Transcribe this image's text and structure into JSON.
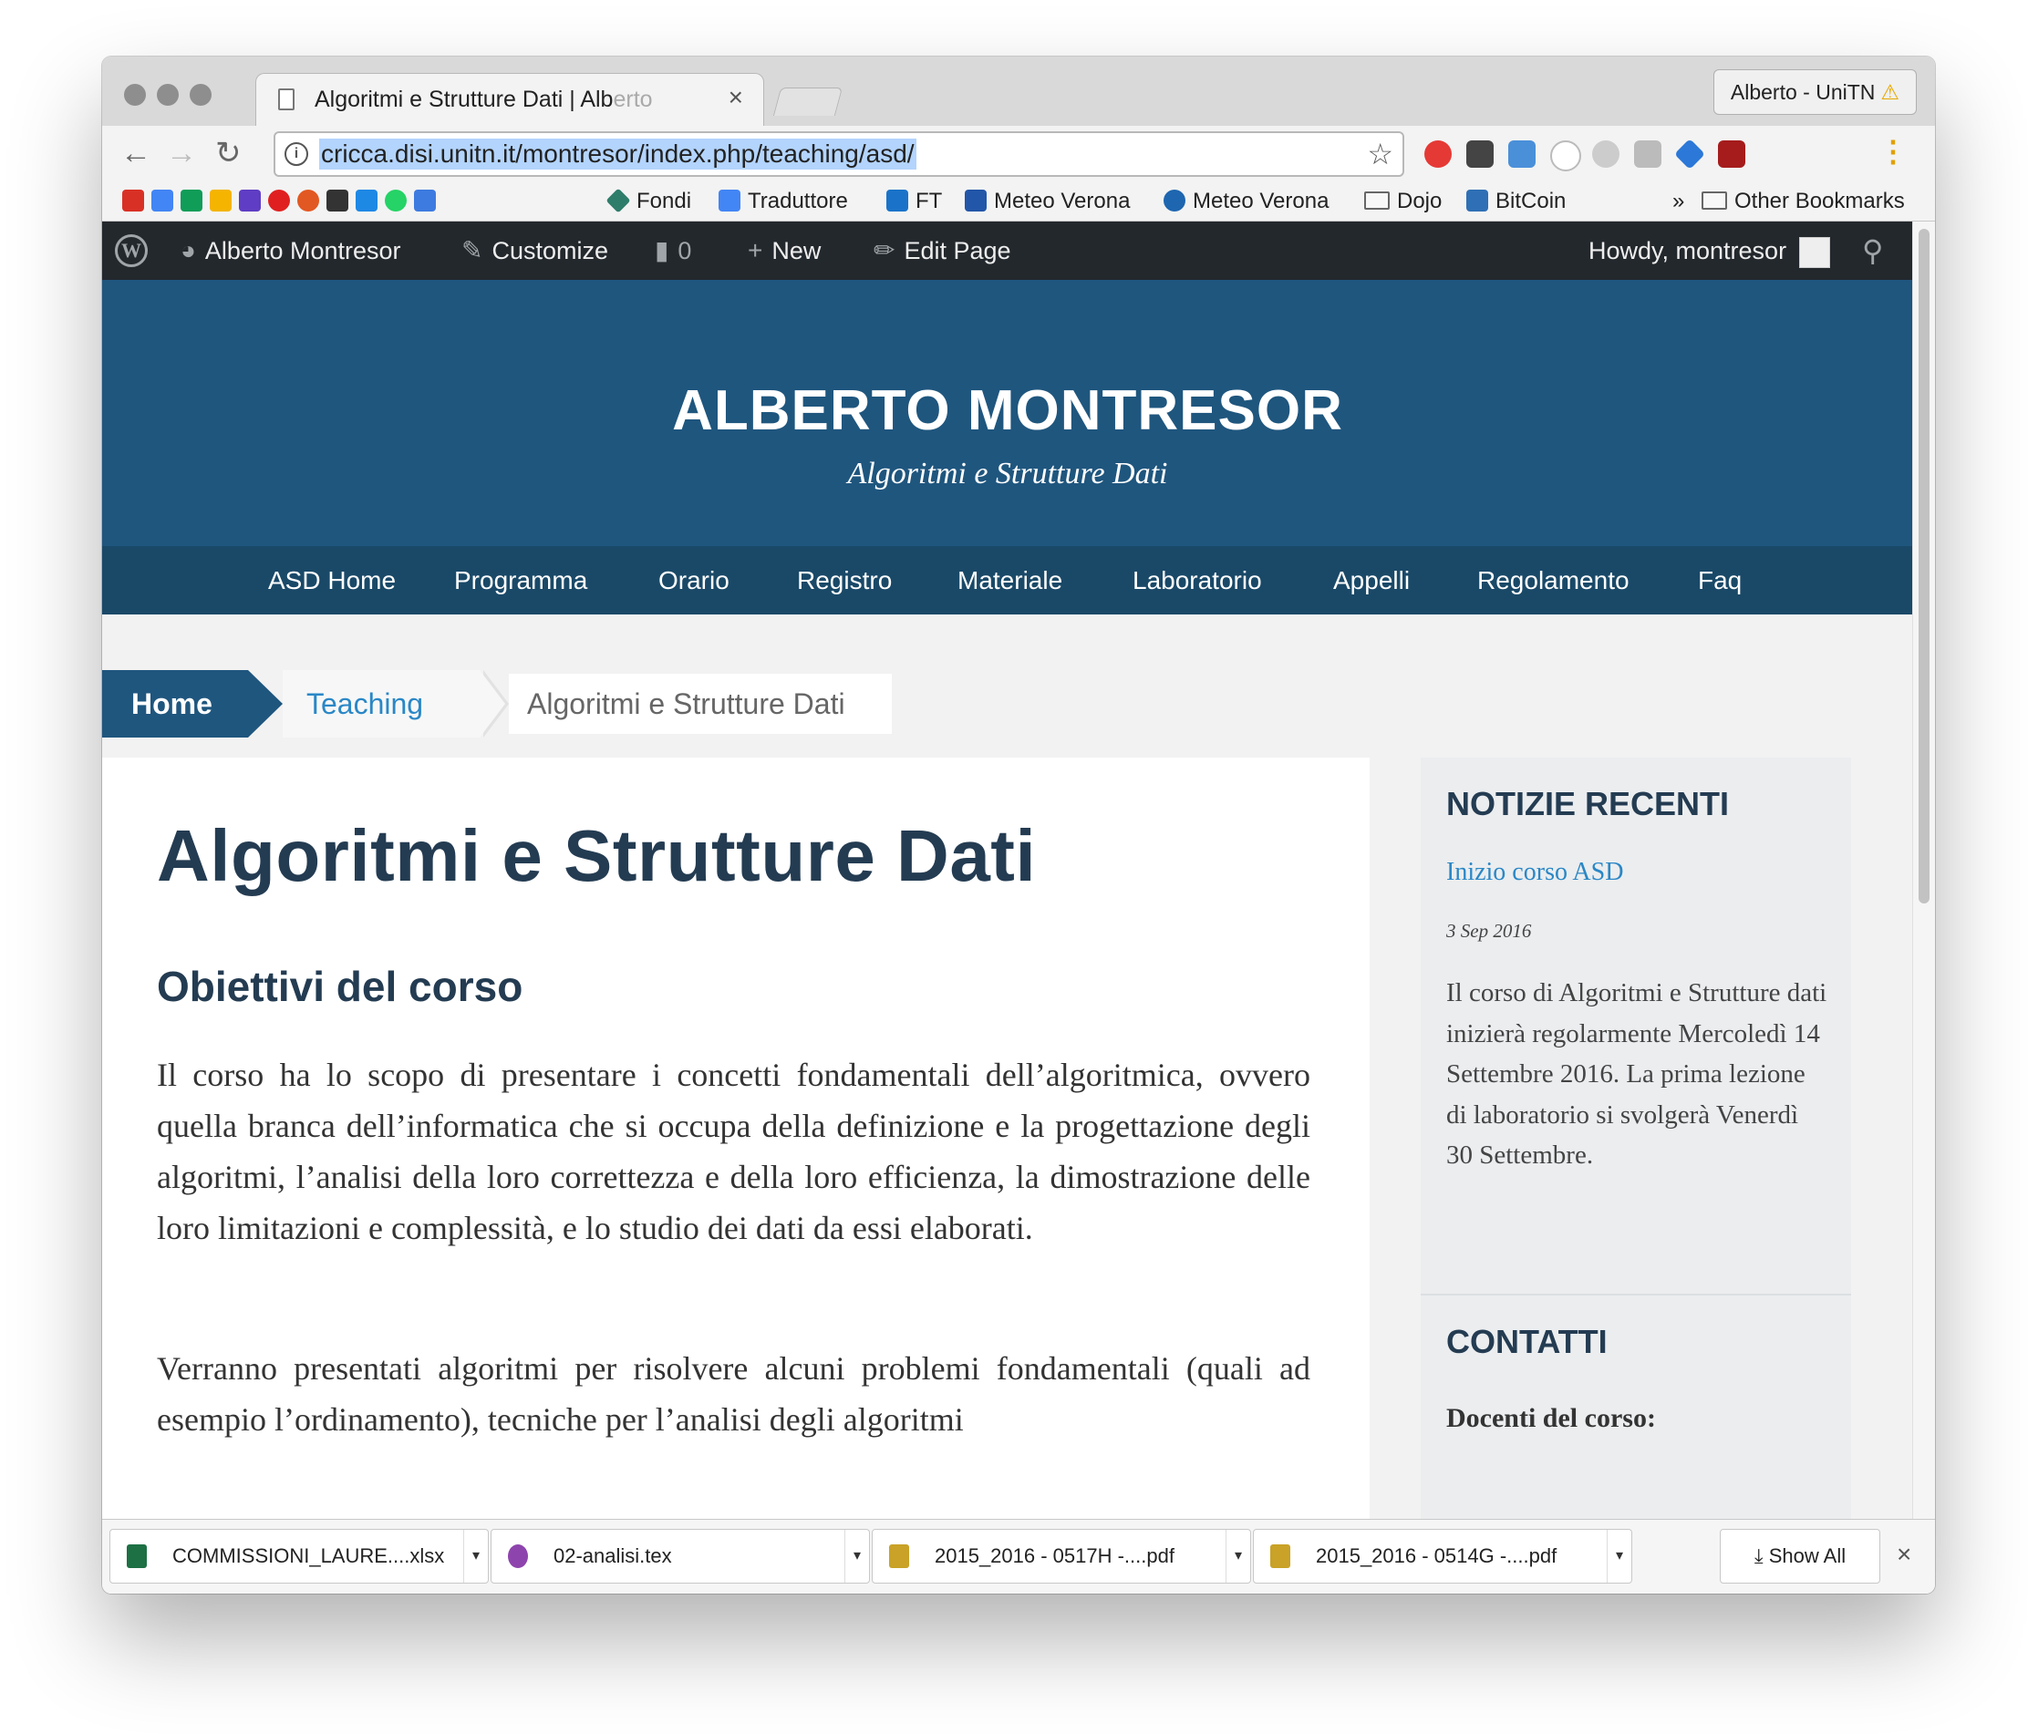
{
  "browser": {
    "tab_title_main": "Algoritmi e Strutture Dati | Alb",
    "tab_title_fade": "erto",
    "close_glyph": "×",
    "profile_name": "Alberto - UniTN",
    "warning_glyph": "⚠",
    "url": "cricca.disi.unitn.it/montresor/index.php/teaching/asd/",
    "back_glyph": "←",
    "forward_glyph": "→",
    "reload_glyph": "↻",
    "info_glyph": "i",
    "star_glyph": "☆",
    "menu_glyph": "⋮"
  },
  "bookmarks": {
    "items": [
      "Fondi",
      "Traduttore",
      "FT",
      "Meteo Verona",
      "Meteo Verona",
      "Dojo",
      "BitCoin"
    ],
    "overflow_glyph": "»",
    "other": "Other Bookmarks",
    "icon_colors": [
      "#d93025",
      "#4285f4",
      "#0f9d58",
      "#f4b400",
      "#5f3dc4",
      "#e02020",
      "#e25822",
      "#333333",
      "#1e88e5",
      "#25d366",
      "#3d7be0"
    ]
  },
  "adminbar": {
    "site": "Alberto Montresor",
    "customize": "Customize",
    "comments": "0",
    "new": "New",
    "edit": "Edit Page",
    "howdy": "Howdy, montresor",
    "wp_glyph": "W",
    "plus_glyph": "+",
    "search_glyph": "⚲"
  },
  "site": {
    "title": "ALBERTO MONTRESOR",
    "tagline": "Algoritmi e Strutture Dati",
    "brand_color": "#1f567e",
    "link_color": "#2a87c6"
  },
  "nav": [
    "ASD Home",
    "Programma",
    "Orario",
    "Registro",
    "Materiale",
    "Laboratorio",
    "Appelli",
    "Regolamento",
    "Faq"
  ],
  "breadcrumb": {
    "home": "Home",
    "middle": "Teaching",
    "current": "Algoritmi e Strutture Dati"
  },
  "content": {
    "title": "Algoritmi e Strutture Dati",
    "section": "Obiettivi del corso",
    "para1": "Il corso ha lo scopo di presentare i concetti fondamentali dell’algoritmica, ovvero quella branca dell’informatica che si occupa della definizione e la progettazione degli algoritmi, l’analisi della loro correttezza e della loro efficienza, la dimostrazione delle loro limitazioni e complessità, e lo studio dei dati da essi elaborati.",
    "para2": "Verranno presentati algoritmi per risolvere alcuni problemi fondamentali (quali ad esempio l’ordinamento), tecniche per l’analisi degli algoritmi"
  },
  "sidebar": {
    "news_title": "NOTIZIE RECENTI",
    "news_link": "Inizio corso ASD",
    "news_date": "3 Sep 2016",
    "news_text": "Il corso di Algoritmi e Strutture dati inizierà regolarmente Mercoledì 14 Settembre 2016. La prima lezione di laboratorio si svolgerà Venerdì 30 Settembre.",
    "contacts_title": "CONTATTI",
    "docenti": "Docenti del corso:"
  },
  "downloads": {
    "items": [
      {
        "name": "COMMISSIONI_LAURE....xlsx",
        "color": "#1d7044"
      },
      {
        "name": "02-analisi.tex",
        "color": "#8e44ad"
      },
      {
        "name": "2015_2016 - 0517H -....pdf",
        "color": "#c9a227"
      },
      {
        "name": "2015_2016 - 0514G -....pdf",
        "color": "#c9a227"
      }
    ],
    "caret_glyph": "▾",
    "show_all": "Show All",
    "download_glyph": "⤓",
    "close_glyph": "×"
  }
}
